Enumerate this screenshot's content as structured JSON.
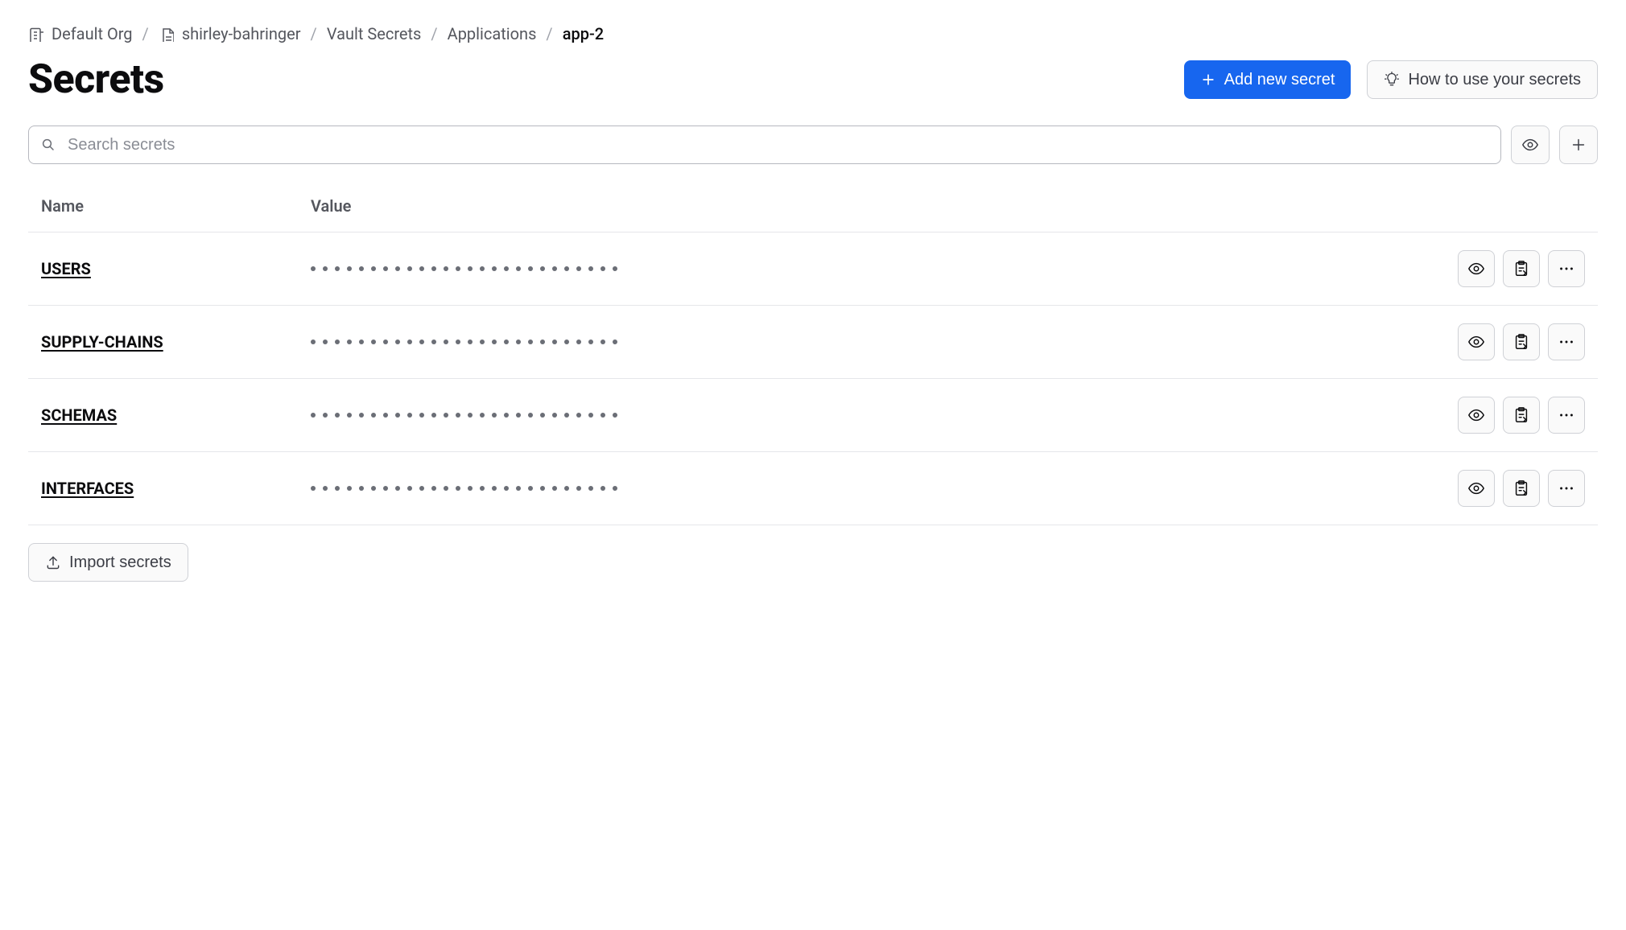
{
  "breadcrumb": {
    "org": "Default Org",
    "project": "shirley-bahringer",
    "product": "Vault Secrets",
    "section": "Applications",
    "current": "app-2"
  },
  "header": {
    "title": "Secrets",
    "add_button": "Add new secret",
    "howto_button": "How to use your secrets"
  },
  "search": {
    "placeholder": "Search secrets"
  },
  "table": {
    "col_name": "Name",
    "col_value": "Value",
    "rows": [
      {
        "name": "USERS"
      },
      {
        "name": "SUPPLY-CHAINS"
      },
      {
        "name": "SCHEMAS"
      },
      {
        "name": "INTERFACES"
      }
    ]
  },
  "footer": {
    "import": "Import secrets"
  }
}
